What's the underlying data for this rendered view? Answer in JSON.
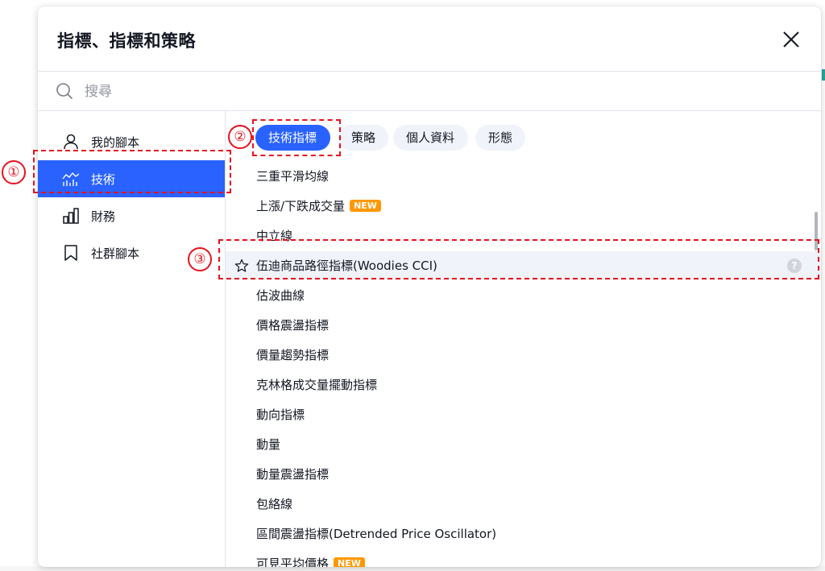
{
  "dialog": {
    "title": "指標、指標和策略",
    "close_label": "×"
  },
  "search": {
    "placeholder": "搜尋"
  },
  "sidebar": {
    "items": [
      {
        "label": "我的腳本",
        "icon": "user-icon"
      },
      {
        "label": "技術",
        "icon": "technicals-chart-icon",
        "active": true
      },
      {
        "label": "財務",
        "icon": "bar-chart-icon"
      },
      {
        "label": "社群腳本",
        "icon": "bookmark-icon"
      }
    ]
  },
  "tabs": [
    {
      "label": "技術指標",
      "active": true
    },
    {
      "label": "策略"
    },
    {
      "label": "個人資料"
    },
    {
      "label": "形態"
    }
  ],
  "indicators": [
    {
      "name": "三重平滑均線"
    },
    {
      "name": "上漲/下跌成交量",
      "badge": "NEW"
    },
    {
      "name": "中立線"
    },
    {
      "name": "伍迪商品路徑指標(Woodies CCI)",
      "highlighted": true
    },
    {
      "name": "估波曲線"
    },
    {
      "name": "價格震盪指標"
    },
    {
      "name": "價量趨勢指標"
    },
    {
      "name": "克林格成交量擺動指標"
    },
    {
      "name": "動向指標"
    },
    {
      "name": "動量"
    },
    {
      "name": "動量震盪指標"
    },
    {
      "name": "包絡線"
    },
    {
      "name": "區間震盪指標(Detrended Price Oscillator)"
    },
    {
      "name": "可見平均價格",
      "badge": "NEW"
    }
  ],
  "help_label": "?",
  "annotations": [
    {
      "number": "①",
      "target": "sidebar-technicals"
    },
    {
      "number": "②",
      "target": "tab-technical-indicators"
    },
    {
      "number": "③",
      "target": "woodies-cci-row"
    }
  ],
  "colors": {
    "accent": "#2962ff",
    "badge": "#ff9800",
    "annotation": "#e8121e",
    "row_highlight": "#f0f3fa"
  }
}
